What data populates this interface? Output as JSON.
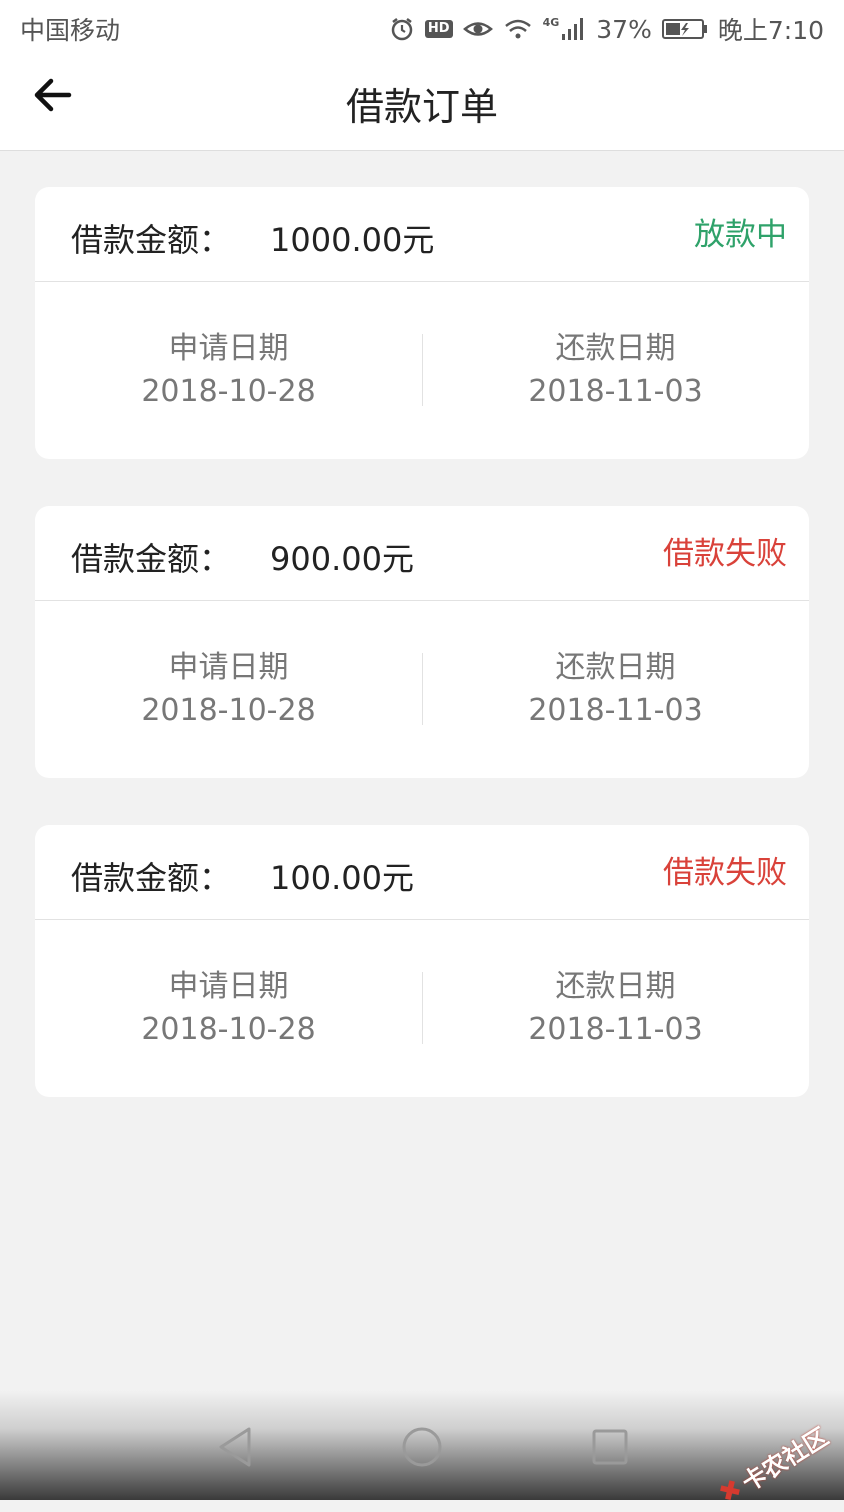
{
  "status_bar": {
    "carrier": "中国移动",
    "network": "4G",
    "battery": "37%",
    "time": "晚上7:10",
    "icons": [
      "alarm-icon",
      "hd-icon",
      "eye-icon",
      "wifi-icon",
      "signal-icon",
      "battery-icon"
    ]
  },
  "header": {
    "title": "借款订单",
    "back_icon": "arrow-left-icon"
  },
  "orders": [
    {
      "amount_label": "借款金额：",
      "amount": "1000.00元",
      "status": "放款中",
      "status_color": "#2fa26a",
      "apply_label": "申请日期",
      "apply_date": "2018-10-28",
      "repay_label": "还款日期",
      "repay_date": "2018-11-03"
    },
    {
      "amount_label": "借款金额：",
      "amount": "900.00元",
      "status": "借款失败",
      "status_color": "#d9423a",
      "apply_label": "申请日期",
      "apply_date": "2018-10-28",
      "repay_label": "还款日期",
      "repay_date": "2018-11-03"
    },
    {
      "amount_label": "借款金额：",
      "amount": "100.00元",
      "status": "借款失败",
      "status_color": "#d9423a",
      "apply_label": "申请日期",
      "apply_date": "2018-10-28",
      "repay_label": "还款日期",
      "repay_date": "2018-11-03"
    }
  ],
  "nav_bar": {
    "buttons": [
      "back-triangle-icon",
      "home-circle-icon",
      "recents-square-icon"
    ]
  },
  "watermark": {
    "text": "卡农社区"
  }
}
